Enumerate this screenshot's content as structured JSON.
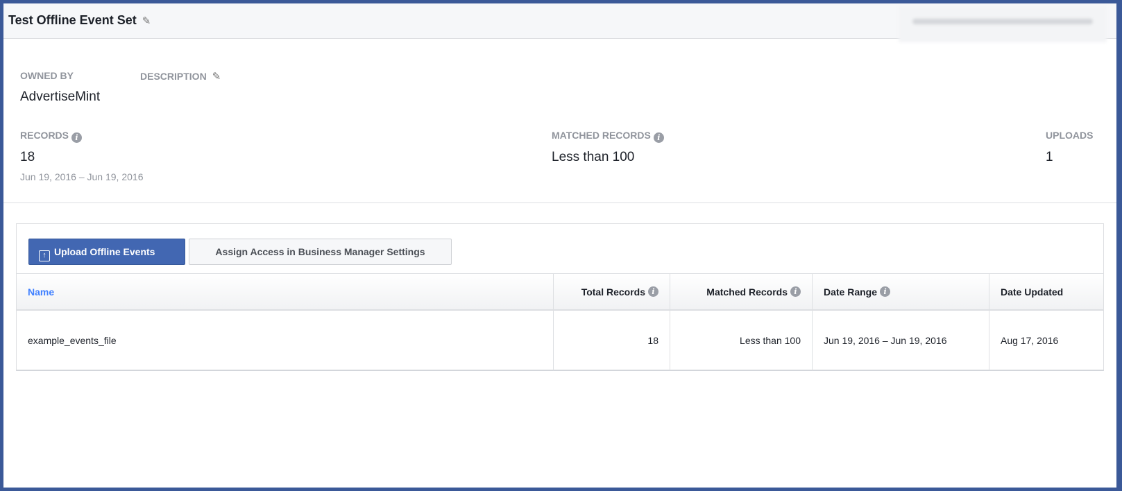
{
  "header": {
    "title": "Test Offline Event Set",
    "edit_icon": "pencil-icon"
  },
  "details": {
    "owned_by": {
      "label": "OWNED BY",
      "value": "AdvertiseMint"
    },
    "description": {
      "label": "DESCRIPTION"
    },
    "records": {
      "label": "RECORDS",
      "value": "18",
      "date_range": "Jun 19, 2016 – Jun 19, 2016"
    },
    "matched_records": {
      "label": "MATCHED RECORDS",
      "value": "Less than 100"
    },
    "uploads": {
      "label": "UPLOADS",
      "value": "1"
    }
  },
  "toolbar": {
    "upload_label": "Upload Offline Events",
    "assign_label": "Assign Access in Business Manager Settings"
  },
  "table": {
    "columns": [
      "Name",
      "Total Records",
      "Matched Records",
      "Date Range",
      "Date Updated"
    ],
    "rows": [
      [
        "example_events_file",
        "18",
        "Less than 100",
        "Jun 19, 2016 – Jun 19, 2016",
        "Aug 17, 2016"
      ]
    ]
  },
  "colors": {
    "border": "#3b5998",
    "primary": "#4267b2",
    "link": "#4080ff"
  }
}
